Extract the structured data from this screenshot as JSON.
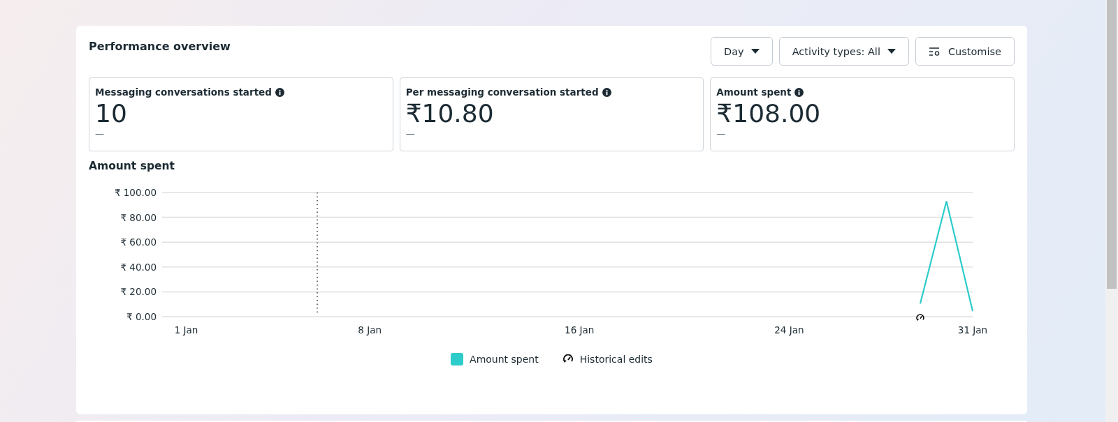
{
  "title": "Performance overview",
  "controls": [
    {
      "kind": "dropdown",
      "label": "Day"
    },
    {
      "kind": "dropdown",
      "label": "Activity types: All"
    },
    {
      "kind": "customise",
      "label": "Customise"
    }
  ],
  "metrics": [
    {
      "label": "Messaging conversations started",
      "value": "10",
      "change": "—"
    },
    {
      "label": "Per messaging conversation started",
      "value": "₹10.80",
      "change": "—"
    },
    {
      "label": "Amount spent",
      "value": "₹108.00",
      "change": "—"
    }
  ],
  "chart_title": "Amount spent",
  "chart_data": {
    "type": "line",
    "categories": [
      "1 Jan",
      null,
      null,
      null,
      null,
      null,
      null,
      "8 Jan",
      null,
      null,
      null,
      null,
      null,
      null,
      null,
      "16 Jan",
      null,
      null,
      null,
      null,
      null,
      null,
      null,
      "24 Jan",
      null,
      null,
      null,
      null,
      null,
      null,
      "31 Jan"
    ],
    "ylim": [
      0,
      100
    ],
    "grid": true,
    "yticks": [
      {
        "value": 0,
        "label": "₹ 0.00"
      },
      {
        "value": 20,
        "label": "₹ 20.00"
      },
      {
        "value": 40,
        "label": "₹ 40.00"
      },
      {
        "value": 60,
        "label": "₹ 60.00"
      },
      {
        "value": 80,
        "label": "₹ 80.00"
      },
      {
        "value": 100,
        "label": "₹ 100.00"
      }
    ],
    "series": [
      {
        "name": "Amount spent",
        "color": "#2ecbcb",
        "values": [
          null,
          null,
          null,
          null,
          null,
          null,
          null,
          null,
          null,
          null,
          null,
          null,
          null,
          null,
          null,
          null,
          null,
          null,
          null,
          null,
          null,
          null,
          null,
          null,
          null,
          null,
          null,
          null,
          10.5,
          93,
          4.5
        ]
      }
    ]
  },
  "historical_edits_label": "Historical edits"
}
